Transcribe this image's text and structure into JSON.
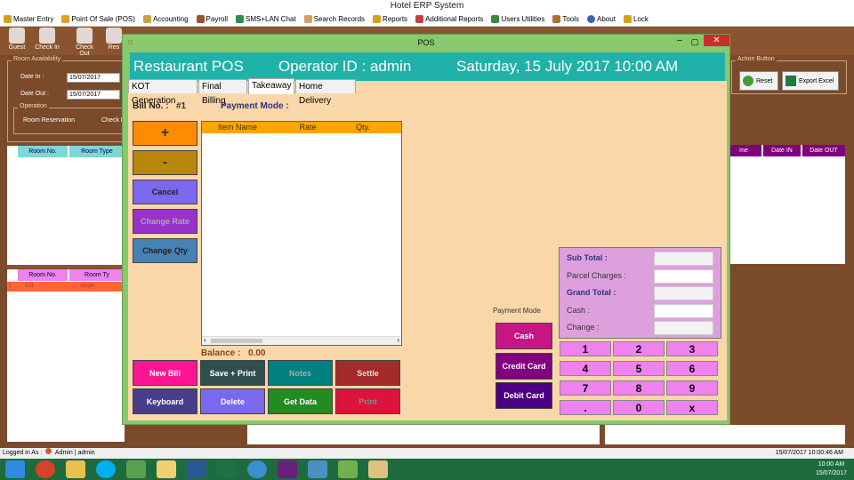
{
  "app": {
    "title": "Hotel ERP System"
  },
  "menu": [
    "Master Entry",
    "Point Of Sale (POS)",
    "Accounting",
    "Payroll",
    "SMS+LAN Chat",
    "Search Records",
    "Reports",
    "Additional Reports",
    "Users Utilities",
    "Tools",
    "About",
    "Lock"
  ],
  "toolbar": [
    "Guest",
    "Check In",
    "Check Out",
    "Res"
  ],
  "room_availability": {
    "title": "Room Availability",
    "date_in_label": "Date In :",
    "date_in": "15/07/2017",
    "date_out_label": "Date Out :",
    "date_out": "15/07/2017"
  },
  "operation": {
    "title": "Operation",
    "opt1": "Room Reservation",
    "opt2": "Check I"
  },
  "grid1_headers": [
    "Room No.",
    "Room Type"
  ],
  "grid2_headers": [
    "Room No.",
    "Room Ty"
  ],
  "grid2_row": {
    "marker": "1",
    "room": "101",
    "type": "Single"
  },
  "right_grid_headers": [
    "me",
    "Date IN",
    "Date OUT"
  ],
  "action": {
    "title": "Action Button",
    "reset": "Reset",
    "export": "Export Excel"
  },
  "status": {
    "logged_in_label": "Logged in As :",
    "role": "Admin",
    "user": "admin",
    "datetime": "15/07/2017 10:00:46 AM"
  },
  "clock": {
    "time": "10:00 AM",
    "date": "15/07/2017"
  },
  "pos": {
    "window_title": "POS",
    "header_title": "Restaurant POS",
    "operator": "Operator ID :  admin",
    "datetime": "Saturday, 15 July 2017 10:00 AM",
    "tabs": [
      "KOT Generation",
      "Final Billing",
      "Takeaway",
      "Home Delivery"
    ],
    "bill_no_label": "Bill No. :",
    "bill_no": "#1",
    "payment_mode_label": "Payment Mode :",
    "side_buttons": {
      "plus": "+",
      "minus": "-",
      "cancel": "Cancel",
      "change_rate": "Change Rate",
      "change_qty": "Change Qty"
    },
    "table_headers": [
      "Item Name",
      "Rate",
      "Qty."
    ],
    "balance_label": "Balance :",
    "balance": "0.00",
    "bottom_buttons": {
      "new_bill": "New Bill",
      "save_print": "Save + Print",
      "notes": "Notes",
      "settle": "Settle",
      "keyboard": "Keyboard",
      "delete": "Delete",
      "get_data": "Get Data",
      "print": "Print"
    },
    "payment_mode_caption": "Payment Mode",
    "payment_buttons": {
      "cash": "Cash",
      "credit": "Credit Card",
      "debit": "Debit Card"
    },
    "totals": {
      "sub_total": "Sub Total :",
      "parcel": "Parcel Charges :",
      "grand_total": "Grand Total :",
      "cash": "Cash :",
      "change": "Change :"
    },
    "keypad": [
      "1",
      "2",
      "3",
      "4",
      "5",
      "6",
      "7",
      "8",
      "9",
      ".",
      "0",
      "x"
    ]
  },
  "colors": {
    "pos_header": "#20b2a8",
    "pos_bg": "#fad7a8",
    "frame": "#88c96e",
    "accent_orange": "#ff8c00"
  }
}
